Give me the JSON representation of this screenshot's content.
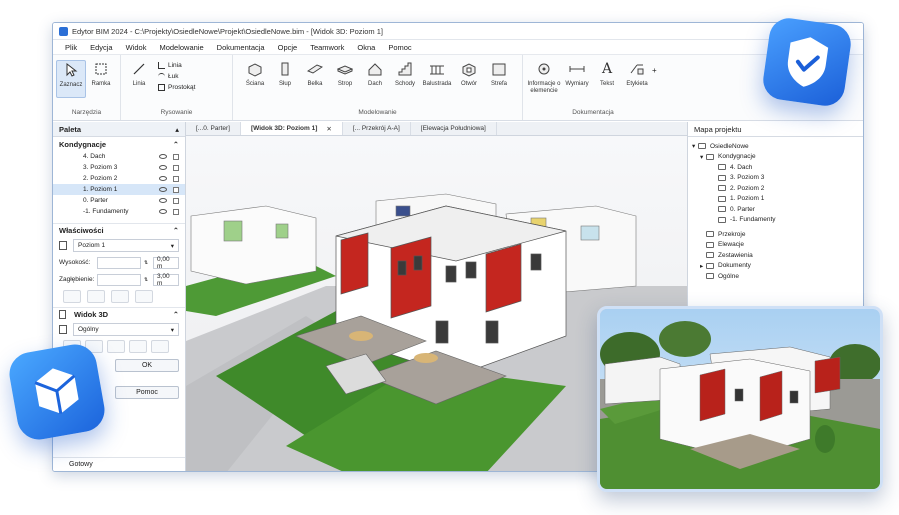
{
  "window": {
    "title": "Edytor BIM 2024 - C:\\Projekty\\OsiedleNowe\\Projekt\\OsiedleNowe.bim - [Widok 3D: Poziom 1]"
  },
  "menu": [
    "Plik",
    "Edycja",
    "Widok",
    "Modelowanie",
    "Dokumentacja",
    "Opcje",
    "Teamwork",
    "Okna",
    "Pomoc"
  ],
  "ribbon": {
    "groups": [
      {
        "label": "Narzędzia",
        "tools": [
          "Zaznacz",
          "Ramka"
        ]
      },
      {
        "label": "Rysowanie",
        "tools": [
          "Linia"
        ],
        "small": [
          "Linia",
          "Łuk",
          "Prostokąt"
        ]
      },
      {
        "label": "Modelowanie",
        "tools": [
          "Ściana",
          "Słup",
          "Belka",
          "Strop",
          "Dach",
          "Schody",
          "Balustrada",
          "Otwór",
          "Strefa"
        ]
      },
      {
        "label": "Dokumentacja",
        "tools": [
          "Informacje o elemencie",
          "Wymiary",
          "Tekst",
          "Etykieta"
        ]
      }
    ]
  },
  "palette": {
    "title": "Paleta",
    "levels_title": "Kondygnacje",
    "levels": [
      "4. Dach",
      "3. Poziom 3",
      "2. Poziom 2",
      "1. Poziom 1",
      "0. Parter",
      "-1. Fundamenty"
    ],
    "selected_level": "1. Poziom 1",
    "properties_title": "Właściwości",
    "properties_level": "Poziom 1",
    "height_label": "Wysokość:",
    "height_value": "0,00 m",
    "depth_label": "Zagłębienie:",
    "depth_value": "3,00 m",
    "view3d_title": "Widok 3D",
    "view3d_mode": "Ogólny",
    "ok_label": "OK",
    "help_label": "Pomoc",
    "status": "Gotowy"
  },
  "tabs": [
    {
      "label": "[...0. Parter]",
      "active": false
    },
    {
      "label": "[Widok 3D: Poziom 1]",
      "active": true
    },
    {
      "label": "[... Przekrój A-A]",
      "active": false
    },
    {
      "label": "[Elewacja Południowa]",
      "active": false
    }
  ],
  "project_map": {
    "title": "Mapa projektu",
    "root": "OsiedleNowe",
    "levels_node": "Kondygnacje",
    "levels": [
      "4. Dach",
      "3. Poziom 3",
      "2. Poziom 2",
      "1. Poziom 1",
      "0. Parter",
      "-1. Fundamenty"
    ],
    "other_nodes": [
      "Przekroje",
      "Elewacje",
      "Zestawienia",
      "Dokumenty",
      "Ogólne"
    ]
  },
  "colors": {
    "accent": "#2b6fd6",
    "badge_blue": "#1b5fd8",
    "facade_red": "#c4261f",
    "lawn_green": "#3f8a2a"
  }
}
